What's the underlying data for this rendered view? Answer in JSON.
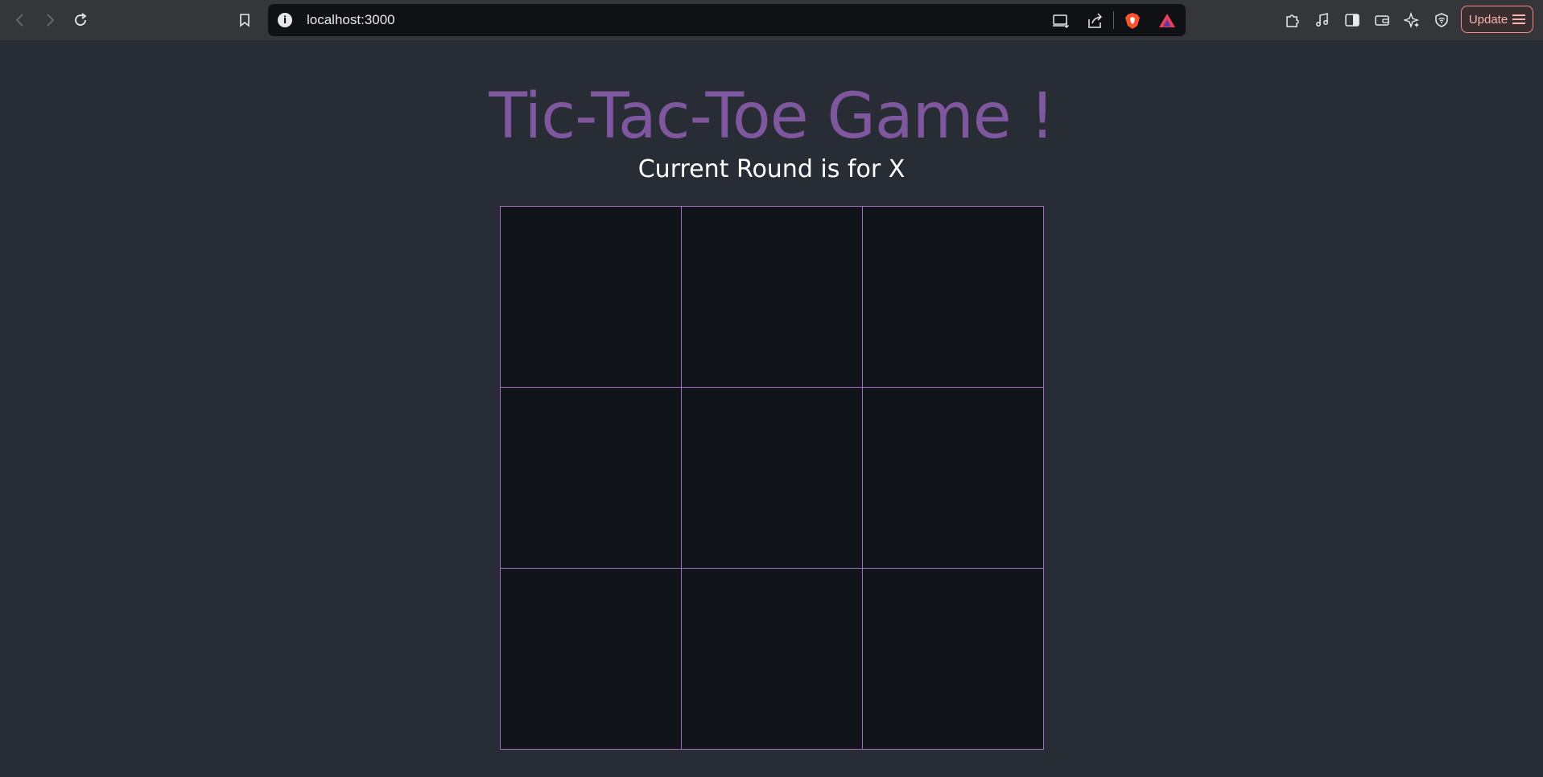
{
  "browser": {
    "url": "localhost:3000",
    "update_label": "Update",
    "icons": [
      "back-icon",
      "forward-icon",
      "reload-icon",
      "bookmark-icon",
      "site-info-icon",
      "install-app-icon",
      "share-icon",
      "brave-shields-icon",
      "brave-rewards-icon",
      "extensions-icon",
      "media-icon",
      "sidebar-icon",
      "wallet-icon",
      "leo-ai-icon",
      "vpn-icon",
      "menu-icon"
    ]
  },
  "game": {
    "title": "Tic-Tac-Toe Game !",
    "status": "Current Round is for X",
    "board": [
      "",
      "",
      "",
      "",
      "",
      "",
      "",
      "",
      ""
    ]
  },
  "colors": {
    "page_background": "#282c34",
    "title": "#7f579f",
    "cell_background": "#11151a",
    "cell_border": "#a070c8"
  }
}
